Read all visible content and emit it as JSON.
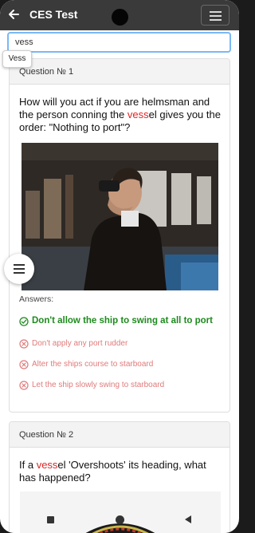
{
  "app": {
    "title": "CES Test"
  },
  "search": {
    "value": "vess",
    "suggestion": "Vess"
  },
  "questions": [
    {
      "header": "Question № 1",
      "text_before": "How will you act if you are helmsman and the person conning the ",
      "highlight": "vess",
      "text_after": "el gives you the order: \"Nothing to port\"?",
      "answers_label": "Answers:",
      "answers": [
        {
          "text": "Don't allow the ship to swing at all to port",
          "correct": true
        },
        {
          "text": "Don't apply any port rudder",
          "correct": false
        },
        {
          "text": "Alter the ships course to starboard",
          "correct": false
        },
        {
          "text": "Let the ship slowly swing to starboard",
          "correct": false
        }
      ]
    },
    {
      "header": "Question № 2",
      "text_before": "If a ",
      "highlight": "vess",
      "text_after": "el 'Overshoots' its heading, what has happened?"
    }
  ],
  "icons": {
    "back": "back-arrow-icon",
    "menu": "hamburger-menu-icon",
    "correct": "check-circle-icon",
    "wrong": "x-circle-icon",
    "fab": "list-menu-icon"
  },
  "colors": {
    "appbar": "#3a3a3a",
    "highlight": "#e02424",
    "correct": "#1e8a1e",
    "wrong": "#e07a7a",
    "search_border": "#7ab8f5"
  }
}
